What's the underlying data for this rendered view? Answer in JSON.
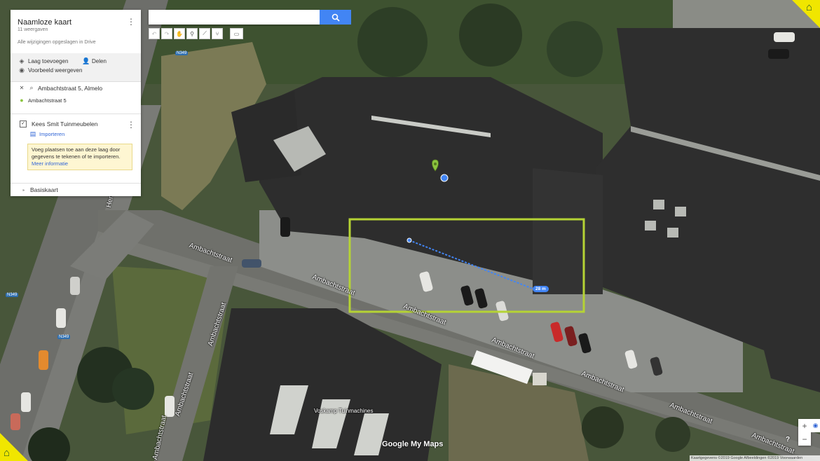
{
  "panel": {
    "title": "Naamloze kaart",
    "views": "11 weergaven",
    "saved": "Alle wijzigingen opgeslagen in Drive",
    "actions": {
      "add_layer": "Laag toevoegen",
      "share": "Delen",
      "preview": "Voorbeeld weergeven"
    },
    "search_result": {
      "query": "Ambachtstraat 5, Almelo",
      "place": "Ambachtstraat 5"
    },
    "layer": {
      "name": "Kees Smit Tuinmeubelen",
      "import": "Importeren",
      "tip_text": "Voeg plaatsen toe aan deze laag door gegevens te tekenen of te importeren.",
      "tip_link": "Meer informatie"
    },
    "basemap": "Basiskaart"
  },
  "search": {
    "value": ""
  },
  "toolbar": {
    "icons": [
      "undo-icon",
      "redo-icon",
      "hand-icon",
      "marker-icon",
      "draw-line-icon",
      "route-icon",
      "ruler-icon"
    ]
  },
  "map": {
    "street_labels": [
      "Hemmeter R",
      "Ambachtstraat",
      "Ambachtstraat",
      "Ambachtstraat",
      "Ambachtstraat",
      "Ambachtstraat",
      "Ambachtstraat",
      "Ambachtstraat",
      "Ambachtstraat",
      "Ambachtstraat"
    ],
    "road_shields": [
      "N349",
      "N349",
      "N349"
    ],
    "poi_label": "Voskamp Tuinmachines",
    "measure_label": "28 m",
    "brand": "Google My Maps",
    "copyright": "Kaartgegevens ©2019 Google Afbeeldingen ©2019    Voorwaarden",
    "help": "?",
    "zoom_in": "+",
    "zoom_out": "−",
    "colors": {
      "highlight": "#b5d334",
      "measure": "#4285f4",
      "marker": "#8bc53f",
      "roof": "#2b2b2b",
      "corner": "#f0e600"
    }
  }
}
